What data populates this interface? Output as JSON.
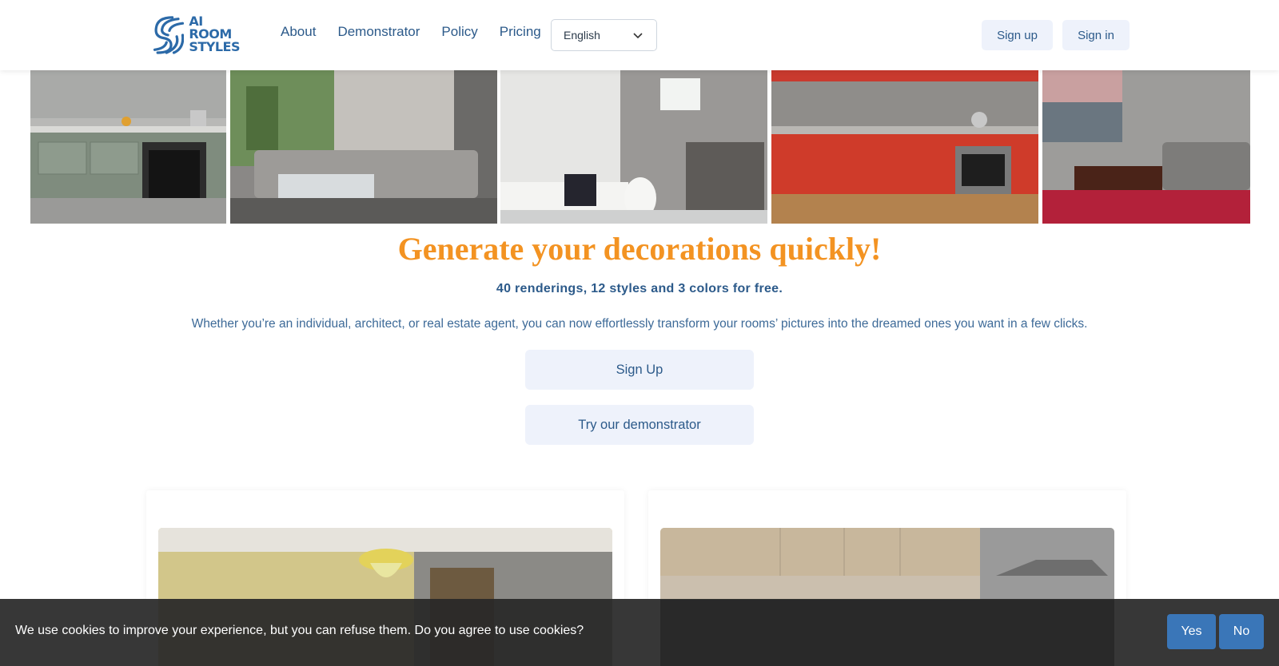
{
  "header": {
    "logo": {
      "line1": "AI",
      "line2": "ROOM",
      "line3": "STYLES"
    },
    "nav": [
      "About",
      "Demonstrator",
      "Policy",
      "Pricing"
    ],
    "language": {
      "selected": "English"
    },
    "signup_label": "Sign up",
    "signin_label": "Sign in"
  },
  "gallery": {
    "images": [
      "kitchen-green-cabinets",
      "living-room-grey-sofa",
      "bathroom-white-tiles",
      "kitchen-red-cabinets",
      "living-room-balcony-view"
    ]
  },
  "hero": {
    "title": "Generate your decorations quickly!",
    "subtitle": "40 renderings, 12 styles and 3 colors for free.",
    "description": "Whether you’re an individual, architect, or real estate agent, you can now effortlessly transform your rooms’ pictures into the dreamed ones you want in a few clicks.",
    "signup_cta": "Sign Up",
    "demo_cta": "Try our demonstrator"
  },
  "cards": [
    {
      "image": "room-yellow-wall-ceiling-lamp"
    },
    {
      "image": "kitchen-wood-cabinets-hood"
    }
  ],
  "cookie": {
    "message": "We use cookies to improve your experience, but you can refuse them. Do you agree to use cookies?",
    "yes_label": "Yes",
    "no_label": "No"
  },
  "colors": {
    "primary_text": "#2c5a8a",
    "accent_orange": "#f39322",
    "button_bg": "#eef2fb",
    "cookie_button": "#3a76b8"
  }
}
